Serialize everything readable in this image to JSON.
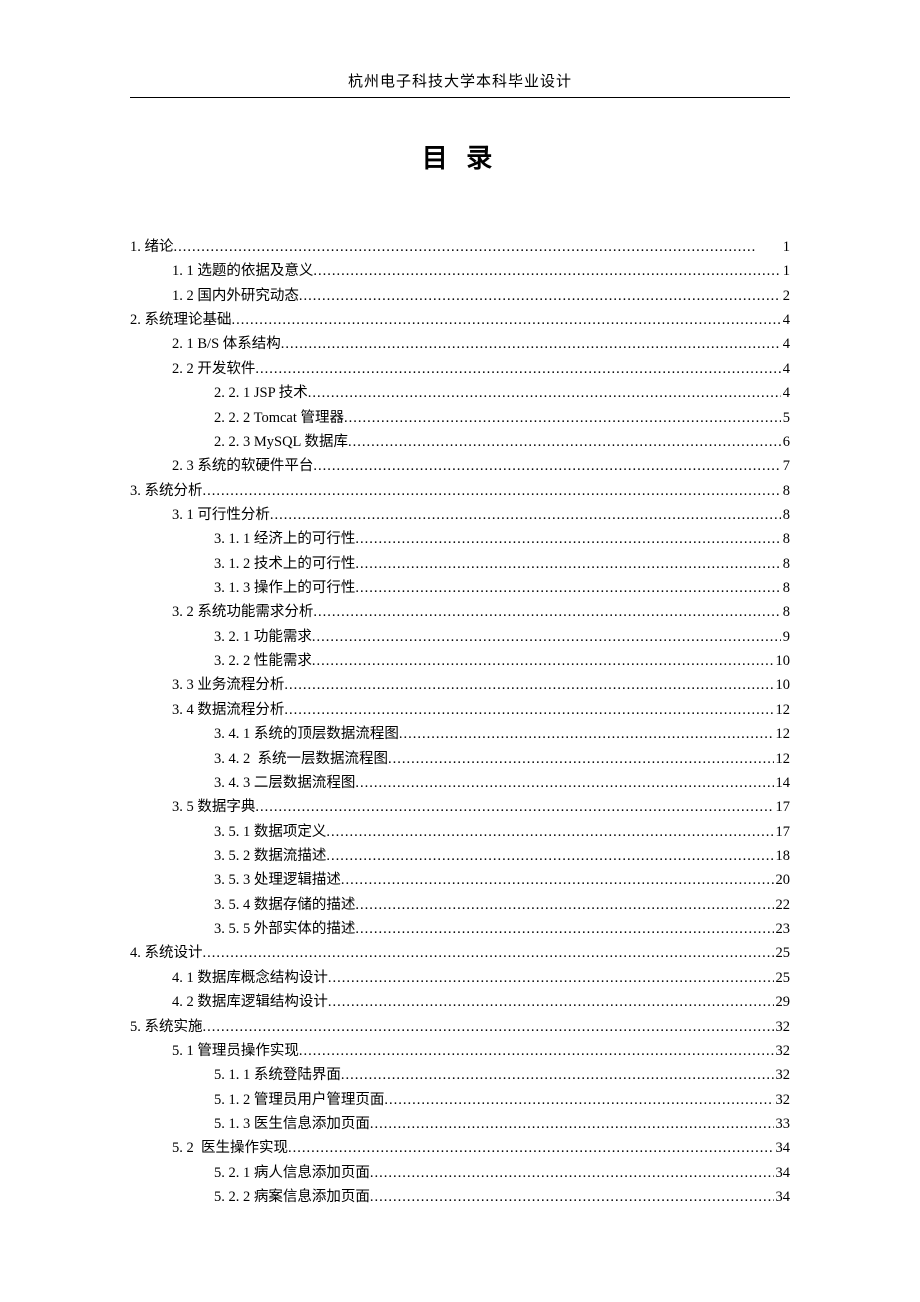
{
  "header": "杭州电子科技大学本科毕业设计",
  "title": "目 录",
  "toc": [
    {
      "level": 0,
      "label": "1. 绪论",
      "page": "1"
    },
    {
      "level": 1,
      "label": "1. 1 选题的依据及意义",
      "page": "1"
    },
    {
      "level": 1,
      "label": "1. 2 国内外研究动态",
      "page": "2"
    },
    {
      "level": 0,
      "label": "2. 系统理论基础",
      "page": "4"
    },
    {
      "level": 1,
      "label": "2. 1 B/S 体系结构",
      "page": "4"
    },
    {
      "level": 1,
      "label": "2. 2 开发软件",
      "page": "4"
    },
    {
      "level": 2,
      "label": "2. 2. 1 JSP 技术",
      "page": "4"
    },
    {
      "level": 2,
      "label": "2. 2. 2 Tomcat 管理器",
      "page": "5"
    },
    {
      "level": 2,
      "label": "2. 2. 3 MySQL 数据库",
      "page": "6"
    },
    {
      "level": 1,
      "label": "2. 3 系统的软硬件平台",
      "page": "7"
    },
    {
      "level": 0,
      "label": "3. 系统分析",
      "page": "8"
    },
    {
      "level": 1,
      "label": "3. 1 可行性分析",
      "page": "8"
    },
    {
      "level": 2,
      "label": "3. 1. 1 经济上的可行性",
      "page": "8"
    },
    {
      "level": 2,
      "label": "3. 1. 2 技术上的可行性",
      "page": "8"
    },
    {
      "level": 2,
      "label": "3. 1. 3 操作上的可行性",
      "page": "8"
    },
    {
      "level": 1,
      "label": "3. 2 系统功能需求分析",
      "page": "8"
    },
    {
      "level": 2,
      "label": "3. 2. 1 功能需求",
      "page": "9"
    },
    {
      "level": 2,
      "label": "3. 2. 2 性能需求",
      "page": "10"
    },
    {
      "level": 1,
      "label": "3. 3 业务流程分析",
      "page": "10"
    },
    {
      "level": 1,
      "label": "3. 4 数据流程分析",
      "page": "12"
    },
    {
      "level": 2,
      "label": "3. 4. 1 系统的顶层数据流程图",
      "page": "12"
    },
    {
      "level": 2,
      "label": "3. 4. 2  系统一层数据流程图",
      "page": "12"
    },
    {
      "level": 2,
      "label": "3. 4. 3 二层数据流程图",
      "page": "14"
    },
    {
      "level": 1,
      "label": "3. 5 数据字典",
      "page": "17"
    },
    {
      "level": 2,
      "label": "3. 5. 1 数据项定义",
      "page": "17"
    },
    {
      "level": 2,
      "label": "3. 5. 2 数据流描述",
      "page": "18"
    },
    {
      "level": 2,
      "label": "3. 5. 3 处理逻辑描述",
      "page": "20"
    },
    {
      "level": 2,
      "label": "3. 5. 4 数据存储的描述",
      "page": "22"
    },
    {
      "level": 2,
      "label": "3. 5. 5 外部实体的描述",
      "page": "23"
    },
    {
      "level": 0,
      "label": "4. 系统设计",
      "page": "25"
    },
    {
      "level": 1,
      "label": "4. 1 数据库概念结构设计",
      "page": "25"
    },
    {
      "level": 1,
      "label": "4. 2 数据库逻辑结构设计",
      "page": "29"
    },
    {
      "level": 0,
      "label": "5. 系统实施",
      "page": "32"
    },
    {
      "level": 1,
      "label": "5. 1 管理员操作实现",
      "page": "32"
    },
    {
      "level": 2,
      "label": "5. 1. 1 系统登陆界面",
      "page": "32"
    },
    {
      "level": 2,
      "label": "5. 1. 2 管理员用户管理页面",
      "page": "32"
    },
    {
      "level": 2,
      "label": "5. 1. 3 医生信息添加页面",
      "page": "33"
    },
    {
      "level": 1,
      "label": "5. 2  医生操作实现",
      "page": "34"
    },
    {
      "level": 2,
      "label": "5. 2. 1 病人信息添加页面",
      "page": "34"
    },
    {
      "level": 2,
      "label": "5. 2. 2 病案信息添加页面",
      "page": "34"
    }
  ]
}
